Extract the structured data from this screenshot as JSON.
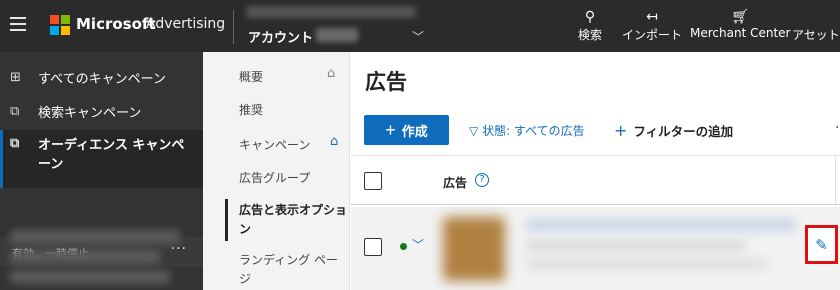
{
  "topbar": {
    "brand": "Microsoft",
    "brand_sub": "Advertising",
    "account_label": "アカウント",
    "items": [
      {
        "label": "検索",
        "icon": "search-icon"
      },
      {
        "label": "インポート",
        "icon": "import-icon"
      },
      {
        "label": "Merchant Center",
        "icon": "cart-icon"
      },
      {
        "label": "アセット",
        "icon": "assets-icon"
      }
    ]
  },
  "leftnav": {
    "items": [
      {
        "label": "すべてのキャンペーン",
        "icon": "all-campaigns-icon"
      },
      {
        "label": "検索キャンペーン",
        "icon": "search-campaign-icon"
      },
      {
        "label": "オーディエンス キャンペーン",
        "icon": "audience-campaign-icon"
      }
    ],
    "filter_label": "有効、一時停止",
    "more": "···"
  },
  "subnav": {
    "items": [
      {
        "label": "概要"
      },
      {
        "label": "推奨"
      },
      {
        "label": "キャンペーン"
      },
      {
        "label": "広告グループ"
      },
      {
        "label": "広告と表示オプション"
      },
      {
        "label": "ランディング ページ"
      }
    ]
  },
  "main": {
    "title": "広告",
    "create_label": "作成",
    "filter_label": "状態: すべての広告",
    "add_filter_label": "フィルターの追加",
    "column_ad": "広告",
    "help": "?"
  },
  "colors": {
    "accent": "#0f6cbd",
    "topbar_bg": "#2b2b2b",
    "leftnav_bg": "#333333",
    "highlight": "#e01010",
    "status_active": "#107c10"
  }
}
